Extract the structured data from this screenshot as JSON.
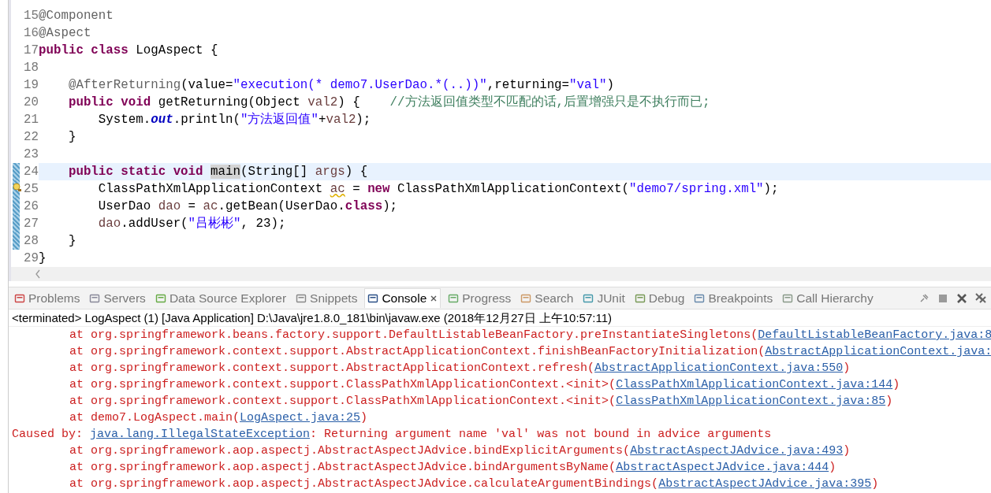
{
  "editor": {
    "lines": [
      {
        "number": "15",
        "current": false,
        "changed": false,
        "warning": false,
        "tokens": [
          {
            "kind": "annotation",
            "text": "@Component"
          }
        ]
      },
      {
        "number": "16",
        "current": false,
        "changed": false,
        "warning": false,
        "tokens": [
          {
            "kind": "annotation",
            "text": "@Aspect"
          }
        ]
      },
      {
        "number": "17",
        "current": false,
        "changed": false,
        "warning": false,
        "tokens": [
          {
            "kind": "keyword",
            "text": "public"
          },
          {
            "kind": "keyword",
            "text": " class"
          },
          {
            "kind": "plain",
            "text": " LogAspect {"
          }
        ]
      },
      {
        "number": "18",
        "current": false,
        "changed": false,
        "warning": false
      },
      {
        "number": "19",
        "current": false,
        "changed": false,
        "warning": false,
        "tokens": [
          {
            "kind": "annotation",
            "text": "    @AfterReturning"
          },
          {
            "kind": "plain",
            "text": "(value="
          },
          {
            "kind": "string",
            "text": "\"execution(* demo7.UserDao.*(..))\""
          },
          {
            "kind": "plain",
            "text": ",returning="
          },
          {
            "kind": "string",
            "text": "\"val\""
          },
          {
            "kind": "plain",
            "text": ")"
          }
        ]
      },
      {
        "number": "20",
        "current": false,
        "changed": false,
        "warning": false,
        "tokens": [
          {
            "kind": "keyword",
            "text": "    public"
          },
          {
            "kind": "keyword",
            "text": " void"
          },
          {
            "kind": "plain",
            "text": " getReturning(Object "
          },
          {
            "kind": "local",
            "text": "val2"
          },
          {
            "kind": "plain",
            "text": ") {"
          },
          {
            "kind": "comment",
            "text": "    //方法返回值类型不匹配的话,后置增强只是不执行而已;"
          }
        ]
      },
      {
        "number": "21",
        "current": false,
        "changed": false,
        "warning": false,
        "tokens": [
          {
            "kind": "plain",
            "text": "        System."
          },
          {
            "kind": "field",
            "text": "out"
          },
          {
            "kind": "plain",
            "text": ".println("
          },
          {
            "kind": "string",
            "text": "\"方法返回值\""
          },
          {
            "kind": "plain",
            "text": "+"
          },
          {
            "kind": "local",
            "text": "val2"
          },
          {
            "kind": "plain",
            "text": ");"
          }
        ]
      },
      {
        "number": "22",
        "current": false,
        "changed": false,
        "warning": false,
        "tokens": [
          {
            "kind": "plain",
            "text": "    }"
          }
        ]
      },
      {
        "number": "23",
        "current": false,
        "changed": false,
        "warning": false
      },
      {
        "number": "24",
        "current": true,
        "changed": true,
        "warning": false,
        "tokens": [
          {
            "kind": "keyword",
            "text": "    public"
          },
          {
            "kind": "keyword",
            "text": " static"
          },
          {
            "kind": "keyword",
            "text": " void"
          },
          {
            "kind": "occurrence",
            "text": " main"
          },
          {
            "kind": "plain",
            "text": "(String[] "
          },
          {
            "kind": "local",
            "text": "args"
          },
          {
            "kind": "plain",
            "text": ") {"
          }
        ]
      },
      {
        "number": "25",
        "current": false,
        "changed": true,
        "warning": true,
        "tokens": [
          {
            "kind": "plain",
            "text": "        ClassPathXmlApplicationContext "
          },
          {
            "kind": "local-warning",
            "text": "ac"
          },
          {
            "kind": "plain",
            "text": " = "
          },
          {
            "kind": "keyword",
            "text": "new"
          },
          {
            "kind": "plain",
            "text": " ClassPathXmlApplicationContext("
          },
          {
            "kind": "string",
            "text": "\"demo7/spring.xml\""
          },
          {
            "kind": "plain",
            "text": ");"
          }
        ]
      },
      {
        "number": "26",
        "current": false,
        "changed": true,
        "warning": false,
        "tokens": [
          {
            "kind": "plain",
            "text": "        UserDao "
          },
          {
            "kind": "local",
            "text": "dao"
          },
          {
            "kind": "plain",
            "text": " = "
          },
          {
            "kind": "local",
            "text": "ac"
          },
          {
            "kind": "plain",
            "text": ".getBean(UserDao."
          },
          {
            "kind": "keyword",
            "text": "class"
          },
          {
            "kind": "plain",
            "text": ");"
          }
        ]
      },
      {
        "number": "27",
        "current": false,
        "changed": true,
        "warning": false,
        "tokens": [
          {
            "kind": "local",
            "text": "        dao"
          },
          {
            "kind": "plain",
            "text": ".addUser("
          },
          {
            "kind": "string",
            "text": "\"吕彬彬\""
          },
          {
            "kind": "plain",
            "text": ", 23);"
          }
        ]
      },
      {
        "number": "28",
        "current": false,
        "changed": true,
        "warning": false,
        "tokens": [
          {
            "kind": "plain",
            "text": "    }"
          }
        ]
      },
      {
        "number": "29",
        "current": false,
        "changed": false,
        "warning": false,
        "tokens": [
          {
            "kind": "plain",
            "text": "}"
          }
        ]
      }
    ]
  },
  "tabs": [
    {
      "label": "Problems",
      "selected": false
    },
    {
      "label": "Servers",
      "selected": false
    },
    {
      "label": "Data Source Explorer",
      "selected": false
    },
    {
      "label": "Snippets",
      "selected": false
    },
    {
      "label": "Console",
      "selected": true
    },
    {
      "label": "Progress",
      "selected": false
    },
    {
      "label": "Search",
      "selected": false
    },
    {
      "label": "JUnit",
      "selected": false
    },
    {
      "label": "Debug",
      "selected": false
    },
    {
      "label": "Breakpoints",
      "selected": false
    },
    {
      "label": "Call Hierarchy",
      "selected": false
    }
  ],
  "console": {
    "header": "<terminated> LogAspect (1) [Java Application] D:\\Java\\jre1.8.0_181\\bin\\javaw.exe (2018年12月27日 上午10:57:11)",
    "lines": [
      {
        "indented": true,
        "text": "at org.springframework.beans.factory.support.DefaultListableBeanFactory.preInstantiateSingletons(",
        "link": "DefaultListableBeanFactory.java:8"
      },
      {
        "indented": true,
        "text": "at org.springframework.context.support.AbstractApplicationContext.finishBeanFactoryInitialization(",
        "link": "AbstractApplicationContext.java:"
      },
      {
        "indented": true,
        "text": "at org.springframework.context.support.AbstractApplicationContext.refresh(",
        "link": "AbstractApplicationContext.java:550",
        "after": ")"
      },
      {
        "indented": true,
        "text": "at org.springframework.context.support.ClassPathXmlApplicationContext.<init>(",
        "link": "ClassPathXmlApplicationContext.java:144",
        "after": ")"
      },
      {
        "indented": true,
        "text": "at org.springframework.context.support.ClassPathXmlApplicationContext.<init>(",
        "link": "ClassPathXmlApplicationContext.java:85",
        "after": ")"
      },
      {
        "indented": true,
        "text": "at demo7.LogAspect.main(",
        "link": "LogAspect.java:25",
        "after": ")"
      },
      {
        "indented": false,
        "text": "Caused by: ",
        "link": "java.lang.IllegalStateException",
        "after": ": Returning argument name 'val' was not bound in advice arguments"
      },
      {
        "indented": true,
        "text": "at org.springframework.aop.aspectj.AbstractAspectJAdvice.bindExplicitArguments(",
        "link": "AbstractAspectJAdvice.java:493",
        "after": ")"
      },
      {
        "indented": true,
        "text": "at org.springframework.aop.aspectj.AbstractAspectJAdvice.bindArgumentsByName(",
        "link": "AbstractAspectJAdvice.java:444",
        "after": ")"
      },
      {
        "indented": true,
        "text": "at org.springframework.aop.aspectj.AbstractAspectJAdvice.calculateArgumentBindings(",
        "link": "AbstractAspectJAdvice.java:395",
        "after": ")"
      }
    ]
  }
}
